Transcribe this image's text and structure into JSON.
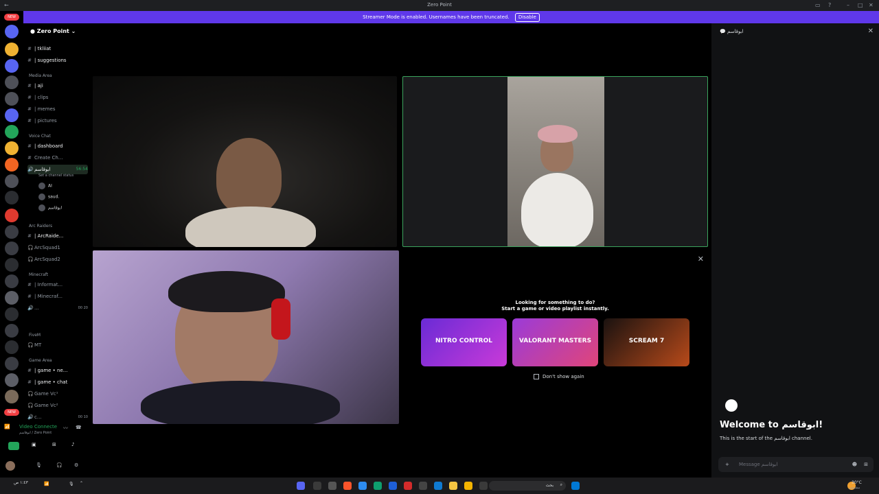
{
  "window": {
    "title": "Zero Point"
  },
  "banner": {
    "text": "Streamer Mode is enabled. Usernames have been truncated.",
    "disable": "Disable"
  },
  "rail": {
    "new_badge": "NEW"
  },
  "server": {
    "name": "Zero Point"
  },
  "channels": [
    {
      "label": "| tkliiat"
    },
    {
      "label": "| suggestions"
    },
    {
      "label": "Media Area"
    },
    {
      "label": "| aji"
    },
    {
      "label": "| clips"
    },
    {
      "label": "| memes"
    },
    {
      "label": "| pictures"
    },
    {
      "label": "Voice Chat"
    },
    {
      "label": "| dashboard"
    },
    {
      "label": "Create Ch..."
    },
    {
      "label": "ابوقاسم"
    },
    {
      "label": "56:54"
    },
    {
      "label": "Set a channel status"
    },
    {
      "label": "AI"
    },
    {
      "label": "saud."
    },
    {
      "label": "ابوقاسم"
    },
    {
      "label": "Arc Raiders"
    },
    {
      "label": "| ArcRaide..."
    },
    {
      "label": "ArcSquad1"
    },
    {
      "label": "ArcSquad2"
    },
    {
      "label": "Minecraft"
    },
    {
      "label": "| Informat..."
    },
    {
      "label": "| Minecraf..."
    },
    {
      "label": "..."
    },
    {
      "label": "00 20"
    },
    {
      "label": "FiveM"
    },
    {
      "label": "MT"
    },
    {
      "label": "Game Area"
    },
    {
      "label": "| game • ne..."
    },
    {
      "label": "| game • chat"
    },
    {
      "label": "Game Vc¹"
    },
    {
      "label": "Game Vc²"
    },
    {
      "label": "c..."
    },
    {
      "label": "00 10"
    }
  ],
  "voice": {
    "status": "Video Connecte",
    "sub": "ابوقاسم / Zero Point"
  },
  "promo": {
    "line1": "Looking for something to do?",
    "line2": "Start a game or video playlist instantly.",
    "cards": [
      "NITRO CONTROL",
      "VALORANT MASTERS",
      "SCREAM 7"
    ],
    "dont_show": "Don't show again"
  },
  "chat": {
    "channel": "ابوقاسم",
    "welcome": "Welcome to ابوقاسم!",
    "start": "This is the start of the ابوقاسم channel.",
    "placeholder": "Message ابوقاسم"
  },
  "taskbar": {
    "search": "بحث",
    "weather": "30°C",
    "weather_sub": "مشمس",
    "clock": "١:٤٣ ص"
  }
}
